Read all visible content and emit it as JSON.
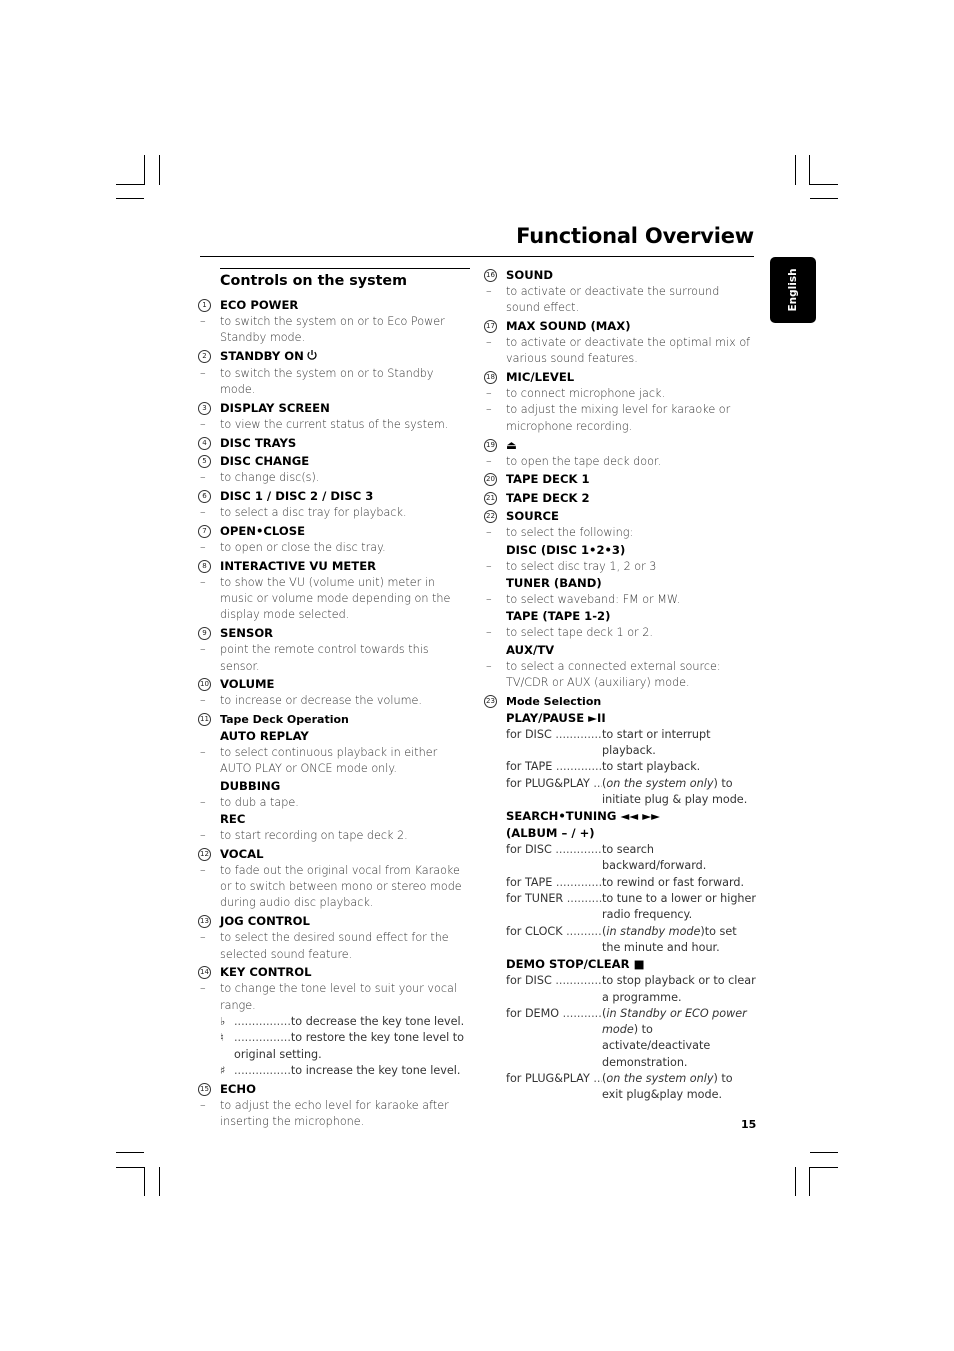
{
  "page": {
    "title": "Functional Overview",
    "language_tab": "English",
    "page_number": "15"
  },
  "left_column": {
    "section_title": "Controls on the system",
    "items": [
      {
        "num": "1",
        "label": "ECO POWER",
        "desc": [
          "to switch the system on or to Eco Power Standby mode."
        ]
      },
      {
        "num": "2",
        "label": "STANDBY ON",
        "icon": "power-icon",
        "desc": [
          "to switch the system on or to Standby mode."
        ]
      },
      {
        "num": "3",
        "label": "DISPLAY SCREEN",
        "desc": [
          "to view the current status of the system."
        ]
      },
      {
        "num": "4",
        "label": "DISC TRAYS",
        "desc": []
      },
      {
        "num": "5",
        "label": "DISC CHANGE",
        "desc": [
          "to change disc(s)."
        ]
      },
      {
        "num": "6",
        "label": "DISC 1 / DISC 2 / DISC 3",
        "desc": [
          "to select a disc tray for playback."
        ]
      },
      {
        "num": "7",
        "label": "OPEN•CLOSE",
        "desc": [
          "to open or close the disc tray."
        ]
      },
      {
        "num": "8",
        "label": "INTERACTIVE VU METER",
        "desc": [
          "to show the VU (volume unit) meter in music or volume mode depending on the display mode selected."
        ]
      },
      {
        "num": "9",
        "label": "SENSOR",
        "desc": [
          "point the remote control towards this sensor."
        ]
      },
      {
        "num": "10",
        "label": "VOLUME",
        "desc": [
          "to increase or decrease the volume."
        ]
      }
    ],
    "tape_deck": {
      "num": "11",
      "label": "Tape Deck Operation",
      "subs": [
        {
          "label": "AUTO REPLAY",
          "desc": "to select continuous playback in either AUTO PLAY or ONCE mode only."
        },
        {
          "label": "DUBBING",
          "desc": "to dub a tape."
        },
        {
          "label": "REC",
          "desc": "to start recording on tape deck 2."
        }
      ]
    },
    "items2": [
      {
        "num": "12",
        "label": "VOCAL",
        "desc": [
          "to fade out the original vocal from Karaoke or to switch between mono or stereo mode during audio disc playback."
        ]
      },
      {
        "num": "13",
        "label": "JOG CONTROL",
        "desc": [
          "to select the desired sound effect for the selected sound feature."
        ]
      }
    ],
    "key_control": {
      "num": "14",
      "label": "KEY CONTROL",
      "desc": "to change the tone level to suit your vocal range.",
      "rows": [
        {
          "symbol": "♭",
          "icon": "flat-icon",
          "dots": "................",
          "text": "to decrease the key tone level."
        },
        {
          "symbol": "♮",
          "icon": "natural-icon",
          "dots": "................",
          "text": "to restore the key tone level to original setting."
        },
        {
          "symbol": "♯",
          "icon": "sharp-icon",
          "dots": "................",
          "text": "to increase the key tone level."
        }
      ]
    },
    "echo": {
      "num": "15",
      "label": "ECHO",
      "desc": "to adjust the echo level for karaoke after inserting the microphone."
    }
  },
  "right_column": {
    "items": [
      {
        "num": "16",
        "label": "SOUND",
        "desc": [
          "to activate or deactivate the surround sound effect."
        ]
      },
      {
        "num": "17",
        "label": "MAX SOUND (MAX)",
        "desc": [
          "to activate or deactivate the optimal mix of various sound features."
        ]
      },
      {
        "num": "18",
        "label": "MIC/LEVEL",
        "desc": [
          "to connect microphone jack.",
          "to adjust the mixing level for karaoke or microphone recording."
        ]
      },
      {
        "num": "19",
        "label": "⏏",
        "icon": "eject-icon",
        "desc": [
          "to open the tape deck door."
        ]
      },
      {
        "num": "20",
        "label": "TAPE DECK 1",
        "desc": []
      },
      {
        "num": "21",
        "label": "TAPE DECK 2",
        "desc": []
      }
    ],
    "source": {
      "num": "22",
      "label": "SOURCE",
      "desc": "to select the following:",
      "subs": [
        {
          "label": "DISC (DISC 1•2•3)",
          "desc": "to select disc tray 1, 2 or 3"
        },
        {
          "label": "TUNER (BAND)",
          "desc": "to select waveband: FM or MW."
        },
        {
          "label": "TAPE (TAPE 1-2)",
          "desc": "to select tape deck 1 or 2."
        },
        {
          "label": "AUX/TV",
          "desc": "to select a connected external source: TV/CDR or AUX (auxiliary) mode."
        }
      ]
    },
    "mode_selection": {
      "num": "23",
      "label": "Mode Selection",
      "groups": [
        {
          "label": "PLAY/PAUSE ►II",
          "rows": [
            {
              "for": "for DISC",
              "dots": " ...................",
              "text": "to start or interrupt playback."
            },
            {
              "for": "for TAPE",
              "dots": " ....................",
              "text": "to start playback."
            },
            {
              "for": "for PLUG&PLAY",
              "dots": " ...",
              "italic": "on the system only",
              "text": ") to initiate plug & play mode."
            }
          ]
        },
        {
          "label": "SEARCH•TUNING ◄◄ ►►",
          "label2": "(ALBUM – / +)",
          "rows": [
            {
              "for": "for DISC",
              "dots": " ...................",
              "text": "to search backward/forward."
            },
            {
              "for": "for TAPE",
              "dots": " ....................",
              "text": "to rewind or fast forward."
            },
            {
              "for": "for TUNER",
              "dots": " .............",
              "text": "to tune to a lower or higher radio frequency."
            },
            {
              "for": "for CLOCK",
              "dots": " .............",
              "italic": "in standby mode",
              "text": ")to set the minute and hour."
            }
          ]
        },
        {
          "label": "DEMO STOP/CLEAR ■",
          "rows": [
            {
              "for": "for DISC",
              "dots": " ...................",
              "text": "to stop playback or to clear a programme."
            },
            {
              "for": "for DEMO",
              "dots": " ...............",
              "italic": "in Standby or ECO power mode",
              "text": ") to activate/deactivate demonstration."
            },
            {
              "for": "for PLUG&PLAY",
              "dots": " ...",
              "italic": "on the system only",
              "text": ") to exit plug&play mode."
            }
          ]
        }
      ]
    }
  }
}
